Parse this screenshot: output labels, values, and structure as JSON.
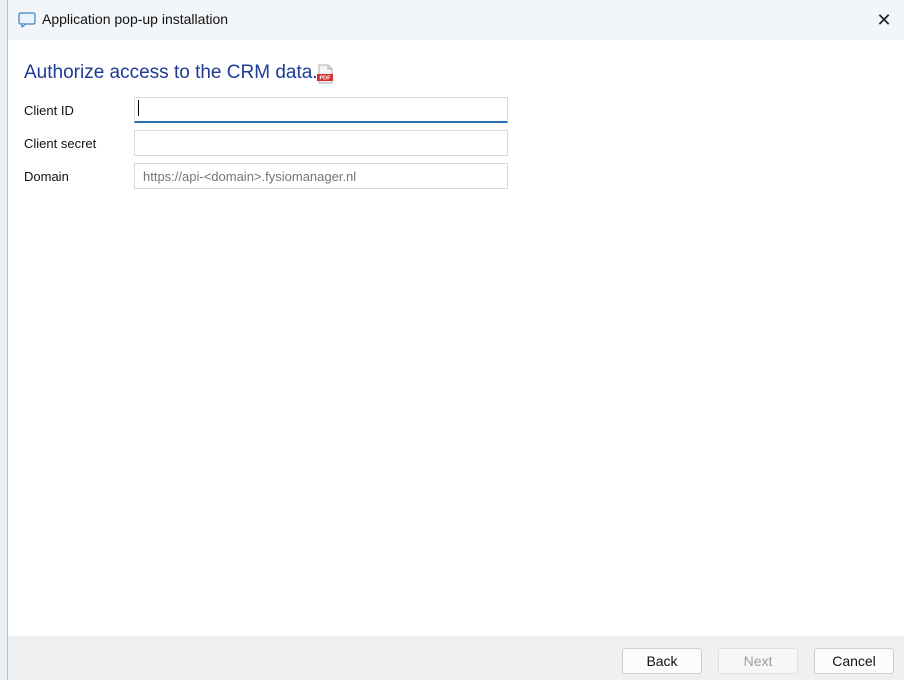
{
  "window": {
    "title": "Application pop-up installation",
    "close_glyph": "✕",
    "icon": "chat-window-icon"
  },
  "main": {
    "heading": "Authorize access to the CRM data.",
    "pdf_icon": "pdf-document-icon",
    "accent_color": "#1f3a93",
    "fields": [
      {
        "label": "Client ID",
        "value": "",
        "placeholder": ""
      },
      {
        "label": "Client secret",
        "value": "",
        "placeholder": ""
      },
      {
        "label": "Domain",
        "value": "",
        "placeholder": "https://api-<domain>.fysiomanager.nl"
      }
    ]
  },
  "footer": {
    "back_label": "Back",
    "next_label": "Next",
    "cancel_label": "Cancel"
  }
}
